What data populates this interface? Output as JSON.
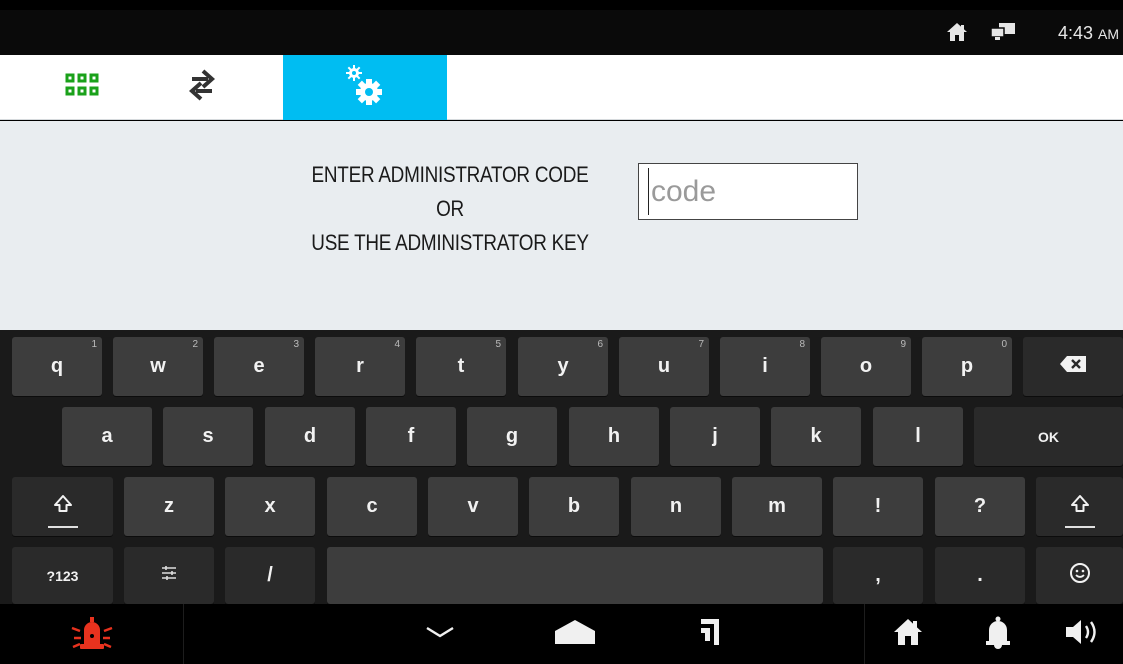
{
  "status_bar": {
    "time": "4:43",
    "ampm": "AM",
    "icons": [
      "home-icon",
      "network-computer-icon"
    ]
  },
  "tabs": [
    {
      "icon": "grid-icon",
      "color": "#1aa11a",
      "active": false
    },
    {
      "icon": "swap-arrows-icon",
      "color": "#333333",
      "active": false
    },
    {
      "icon": "settings-gears-icon",
      "color": "#ffffff",
      "active": true
    }
  ],
  "accent_color": "#00bdf2",
  "prompt": {
    "line1": "ENTER ADMINISTRATOR CODE",
    "line2": "OR",
    "line3": "USE THE ADMINISTRATOR KEY"
  },
  "code_input": {
    "placeholder": "code",
    "value": ""
  },
  "keyboard": {
    "row1": [
      {
        "label": "q",
        "hint": "1"
      },
      {
        "label": "w",
        "hint": "2"
      },
      {
        "label": "e",
        "hint": "3"
      },
      {
        "label": "r",
        "hint": "4"
      },
      {
        "label": "t",
        "hint": "5"
      },
      {
        "label": "y",
        "hint": "6"
      },
      {
        "label": "u",
        "hint": "7"
      },
      {
        "label": "i",
        "hint": "8"
      },
      {
        "label": "o",
        "hint": "9"
      },
      {
        "label": "p",
        "hint": "0"
      }
    ],
    "row2": [
      "a",
      "s",
      "d",
      "f",
      "g",
      "h",
      "j",
      "k",
      "l"
    ],
    "ok_label": "OK",
    "row3": [
      "z",
      "x",
      "c",
      "v",
      "b",
      "n",
      "m",
      "!",
      "?"
    ],
    "symbols_label": "?123",
    "slash_label": "/",
    "comma_label": ",",
    "period_label": "."
  },
  "nav_bar": {
    "alarm_color": "#e8321e",
    "buttons": [
      "alarm-icon",
      "hide-keyboard-icon",
      "home-icon",
      "recent-apps-icon",
      "house-icon",
      "bell-icon",
      "volume-icon"
    ]
  }
}
